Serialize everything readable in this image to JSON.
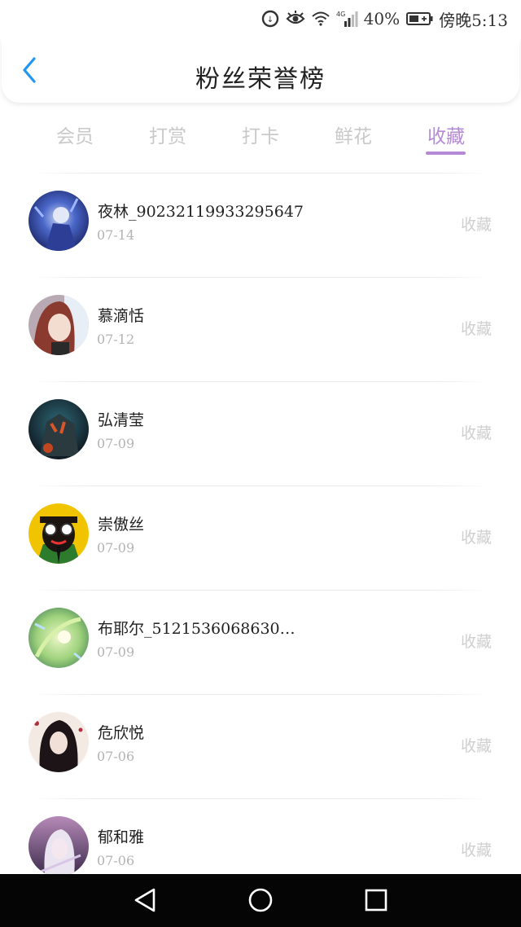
{
  "status_bar": {
    "battery": "40%",
    "time": "傍晚5:13",
    "network": "4G",
    "icons": [
      "data-saver-icon",
      "eye-icon",
      "wifi-icon",
      "signal-icon",
      "battery-icon"
    ]
  },
  "header": {
    "title": "粉丝荣誉榜",
    "back_icon": "chevron-left-icon"
  },
  "tabs": [
    {
      "label": "会员",
      "active": false
    },
    {
      "label": "打赏",
      "active": false
    },
    {
      "label": "打卡",
      "active": false
    },
    {
      "label": "鲜花",
      "active": false
    },
    {
      "label": "收藏",
      "active": true
    }
  ],
  "colors": {
    "accent": "#b48ad6",
    "tab_inactive": "#c9c9c9",
    "back": "#2196f3",
    "nav_bg": "#050505"
  },
  "fans": [
    {
      "name": "夜林_90232119933295647",
      "date": "07-14",
      "action": "收藏"
    },
    {
      "name": "慕滴恬",
      "date": "07-12",
      "action": "收藏"
    },
    {
      "name": "弘清莹",
      "date": "07-09",
      "action": "收藏"
    },
    {
      "name": "崇傲丝",
      "date": "07-09",
      "action": "收藏"
    },
    {
      "name": "布耶尔_5121536068630…",
      "date": "07-09",
      "action": "收藏"
    },
    {
      "name": "危欣悦",
      "date": "07-06",
      "action": "收藏"
    },
    {
      "name": "郁和雅",
      "date": "07-06",
      "action": "收藏"
    }
  ],
  "nav": [
    "back-triangle-icon",
    "home-circle-icon",
    "recents-square-icon"
  ]
}
